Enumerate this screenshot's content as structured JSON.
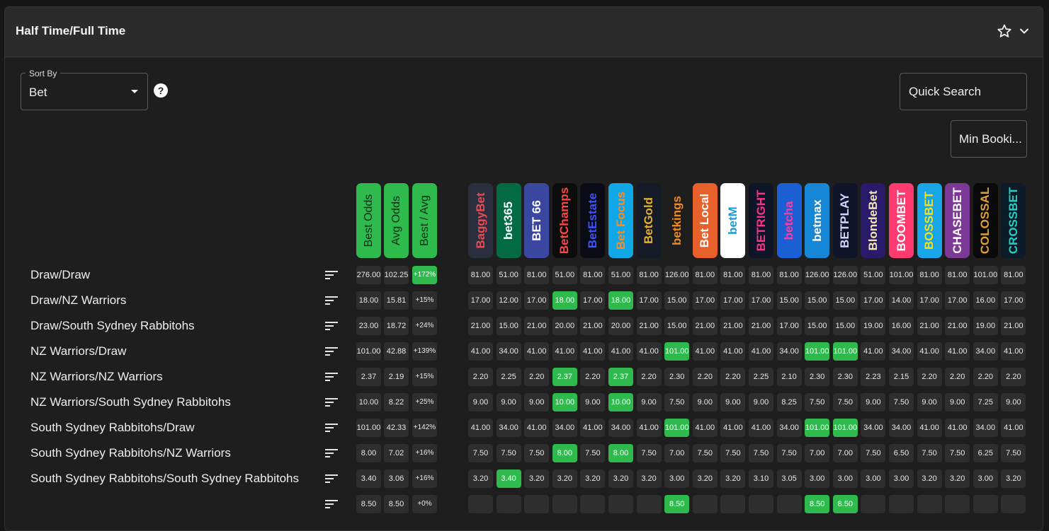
{
  "panel": {
    "title": "Half Time/Full Time",
    "star_icon": "star-outline-icon",
    "collapse_icon": "chevron-down-icon"
  },
  "controls": {
    "sort_label": "Sort By",
    "sort_value": "Bet",
    "help_glyph": "?",
    "quick_search_placeholder": "Quick Search",
    "min_bookies_label": "Min Booki..."
  },
  "summary_headers": [
    "Best Odds",
    "Avg Odds",
    "Best / Avg"
  ],
  "bookmakers": [
    {
      "name": "BaggyBet",
      "bg": "#2a2e3d",
      "fg": "#e94a55"
    },
    {
      "name": "bet365",
      "bg": "#026b43",
      "fg": "#ffffff"
    },
    {
      "name": "BET 66",
      "bg": "#3a46a0",
      "fg": "#ffffff"
    },
    {
      "name": "BetChamps",
      "bg": "#0c0c0c",
      "fg": "#ff4545"
    },
    {
      "name": "BetEstate",
      "bg": "#0b0b16",
      "fg": "#3a52ff"
    },
    {
      "name": "Bet Focus",
      "bg": "#10a7e6",
      "fg": "#ff8a1f"
    },
    {
      "name": "BetGold",
      "bg": "#151a26",
      "fg": "#e0b030"
    },
    {
      "name": "betkings",
      "bg": "#1e1e1e",
      "fg": "#f08a1e"
    },
    {
      "name": "Bet Local",
      "bg": "#e8602a",
      "fg": "#ffffff"
    },
    {
      "name": "betM",
      "bg": "#ffffff",
      "fg": "#1a9bd8"
    },
    {
      "name": "BETRIGHT",
      "bg": "#0e1526",
      "fg": "#ff2f8a"
    },
    {
      "name": "betcha",
      "bg": "#1a5fd4",
      "fg": "#ff3aa0"
    },
    {
      "name": "betmax",
      "bg": "#1587d6",
      "fg": "#ffffff"
    },
    {
      "name": "BETPLAY",
      "bg": "#101428",
      "fg": "#cfd6ff"
    },
    {
      "name": "BlondeBet",
      "bg": "#2a1a6a",
      "fg": "#f2e6a8"
    },
    {
      "name": "BOOMBET",
      "bg": "#ff3a6e",
      "fg": "#ffffff"
    },
    {
      "name": "BOSSBET",
      "bg": "#18a6e8",
      "fg": "#f5e11b"
    },
    {
      "name": "CHASEBET",
      "bg": "#7c3a96",
      "fg": "#ffffff"
    },
    {
      "name": "COLOSSAL",
      "bg": "#0a0a0a",
      "fg": "#e0a030"
    },
    {
      "name": "CROSSBET",
      "bg": "#0b1b2a",
      "fg": "#21d0c0"
    }
  ],
  "rows": [
    {
      "label": "Draw/Draw",
      "best": "276.00",
      "avg": "102.25",
      "pct": "+172%",
      "odds": [
        "81.00",
        "51.00",
        "81.00",
        "51.00",
        "81.00",
        "51.00",
        "81.00",
        "126.00",
        "81.00",
        "81.00",
        "81.00",
        "81.00",
        "126.00",
        "126.00",
        "51.00",
        "101.00",
        "81.00",
        "81.00",
        "101.00",
        "81.00"
      ],
      "hl": []
    },
    {
      "label": "Draw/NZ Warriors",
      "best": "18.00",
      "avg": "15.81",
      "pct": "+15%",
      "odds": [
        "17.00",
        "12.00",
        "17.00",
        "18.00",
        "17.00",
        "18.00",
        "17.00",
        "15.00",
        "17.00",
        "17.00",
        "17.00",
        "15.00",
        "15.00",
        "15.00",
        "17.00",
        "14.00",
        "17.00",
        "17.00",
        "16.00",
        "17.00"
      ],
      "hl": [
        3,
        5
      ]
    },
    {
      "label": "Draw/South Sydney Rabbitohs",
      "best": "23.00",
      "avg": "18.72",
      "pct": "+24%",
      "odds": [
        "21.00",
        "15.00",
        "21.00",
        "20.00",
        "21.00",
        "20.00",
        "21.00",
        "15.00",
        "21.00",
        "21.00",
        "21.00",
        "17.00",
        "15.00",
        "15.00",
        "19.00",
        "16.00",
        "21.00",
        "21.00",
        "19.00",
        "21.00"
      ],
      "hl": []
    },
    {
      "label": "NZ Warriors/Draw",
      "best": "101.00",
      "avg": "42.88",
      "pct": "+139%",
      "odds": [
        "41.00",
        "34.00",
        "41.00",
        "41.00",
        "41.00",
        "41.00",
        "41.00",
        "101.00",
        "41.00",
        "41.00",
        "41.00",
        "34.00",
        "101.00",
        "101.00",
        "41.00",
        "34.00",
        "41.00",
        "41.00",
        "34.00",
        "41.00"
      ],
      "hl": [
        7,
        12,
        13
      ]
    },
    {
      "label": "NZ Warriors/NZ Warriors",
      "best": "2.37",
      "avg": "2.19",
      "pct": "+15%",
      "odds": [
        "2.20",
        "2.25",
        "2.20",
        "2.37",
        "2.20",
        "2.37",
        "2.20",
        "2.30",
        "2.20",
        "2.20",
        "2.25",
        "2.10",
        "2.30",
        "2.30",
        "2.23",
        "2.15",
        "2.20",
        "2.20",
        "2.20",
        "2.20"
      ],
      "hl": [
        3,
        5
      ]
    },
    {
      "label": "NZ Warriors/South Sydney Rabbitohs",
      "best": "10.00",
      "avg": "8.22",
      "pct": "+25%",
      "odds": [
        "9.00",
        "9.00",
        "9.00",
        "10.00",
        "9.00",
        "10.00",
        "9.00",
        "7.50",
        "9.00",
        "9.00",
        "9.00",
        "8.25",
        "7.50",
        "7.50",
        "9.00",
        "7.50",
        "9.00",
        "9.00",
        "7.25",
        "9.00"
      ],
      "hl": [
        3,
        5
      ]
    },
    {
      "label": "South Sydney Rabbitohs/Draw",
      "best": "101.00",
      "avg": "42.33",
      "pct": "+142%",
      "odds": [
        "41.00",
        "34.00",
        "41.00",
        "34.00",
        "41.00",
        "34.00",
        "41.00",
        "101.00",
        "41.00",
        "41.00",
        "41.00",
        "34.00",
        "101.00",
        "101.00",
        "34.00",
        "34.00",
        "41.00",
        "41.00",
        "34.00",
        "41.00"
      ],
      "hl": [
        7,
        12,
        13
      ]
    },
    {
      "label": "South Sydney Rabbitohs/NZ Warriors",
      "best": "8.00",
      "avg": "7.02",
      "pct": "+16%",
      "odds": [
        "7.50",
        "7.50",
        "7.50",
        "8.00",
        "7.50",
        "8.00",
        "7.50",
        "7.00",
        "7.50",
        "7.50",
        "7.50",
        "7.50",
        "7.00",
        "7.00",
        "7.50",
        "6.50",
        "7.50",
        "7.50",
        "6.25",
        "7.50"
      ],
      "hl": [
        3,
        5
      ]
    },
    {
      "label": "South Sydney Rabbitohs/South Sydney Rabbitohs",
      "best": "3.40",
      "avg": "3.06",
      "pct": "+16%",
      "odds": [
        "3.20",
        "3.40",
        "3.20",
        "3.20",
        "3.20",
        "3.20",
        "3.20",
        "3.00",
        "3.20",
        "3.20",
        "3.10",
        "3.05",
        "3.00",
        "3.00",
        "3.00",
        "3.00",
        "3.20",
        "3.20",
        "3.00",
        "3.20"
      ],
      "hl": [
        1
      ]
    },
    {
      "label": "",
      "best": "8.50",
      "avg": "8.50",
      "pct": "+0%",
      "odds": [
        "",
        "",
        "",
        "",
        "",
        "",
        "",
        "8.50",
        "",
        "",
        "",
        "",
        "8.50",
        "8.50",
        "",
        "",
        "",
        "",
        "",
        ""
      ],
      "hl": [
        7,
        12,
        13
      ]
    }
  ]
}
